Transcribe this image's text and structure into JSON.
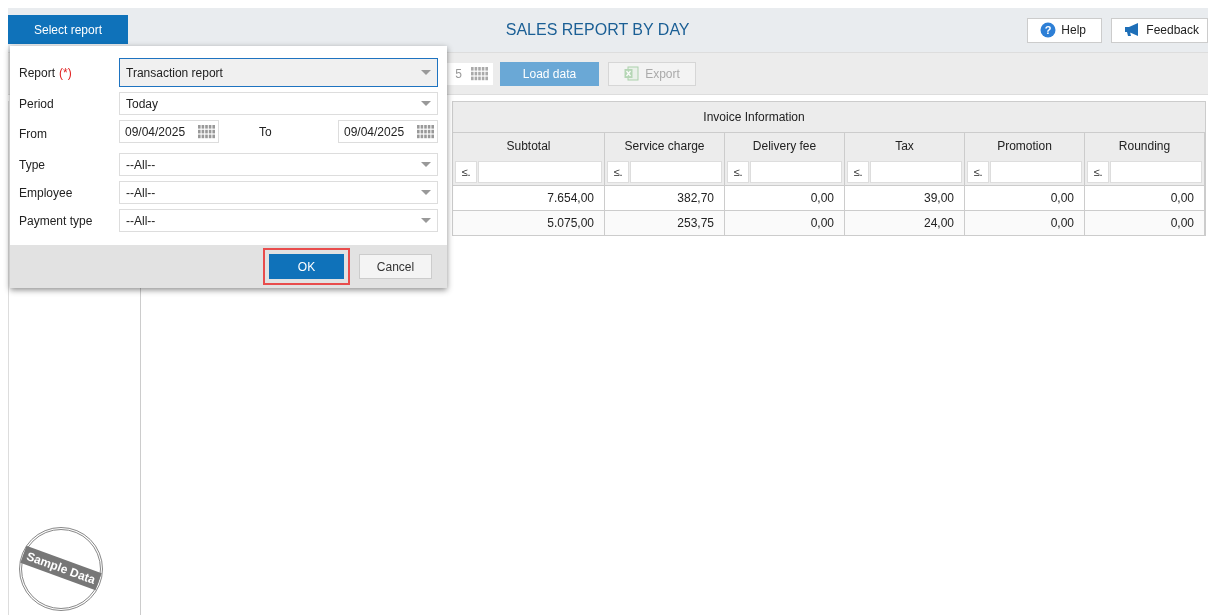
{
  "header": {
    "select_report": "Select report",
    "title": "SALES REPORT BY DAY",
    "help_icon": "?",
    "help": "Help",
    "feedback": "Feedback"
  },
  "toolbar": {
    "date_fragment": "5",
    "load": "Load data",
    "export": "Export",
    "export_disabled": true
  },
  "table": {
    "group": "Invoice Information",
    "columns": [
      {
        "label": "Subtotal",
        "operator": "≤."
      },
      {
        "label": "Service charge",
        "operator": "≤."
      },
      {
        "label": "Delivery fee",
        "operator": "≤."
      },
      {
        "label": "Tax",
        "operator": "≤."
      },
      {
        "label": "Promotion",
        "operator": "≤."
      },
      {
        "label": "Rounding",
        "operator": "≤."
      }
    ],
    "rows": [
      [
        "7.654,00",
        "382,70",
        "0,00",
        "39,00",
        "0,00",
        "0,00"
      ],
      [
        "5.075,00",
        "253,75",
        "0,00",
        "24,00",
        "0,00",
        "0,00"
      ]
    ]
  },
  "badge": "Sample Data",
  "dialog": {
    "fields": [
      {
        "kind": "select",
        "label": "Report",
        "required_mark": "(*)",
        "value": "Transaction report",
        "focused": true
      },
      {
        "kind": "select",
        "label": "Period",
        "value": "Today",
        "focused": false
      },
      {
        "kind": "daterange",
        "label": "From",
        "value": "09/04/2025",
        "to_label": "To",
        "to_value": "09/04/2025",
        "focused": false
      },
      {
        "kind": "select",
        "label": "Type",
        "value": "--All--",
        "focused": false
      },
      {
        "kind": "select",
        "label": "Employee",
        "value": "--All--",
        "focused": false
      },
      {
        "kind": "select",
        "label": "Payment type",
        "value": "--All--",
        "focused": false
      }
    ],
    "buttons": [
      {
        "label": "OK",
        "primary": true,
        "highlighted": true
      },
      {
        "label": "Cancel",
        "primary": false,
        "highlighted": false
      }
    ]
  }
}
